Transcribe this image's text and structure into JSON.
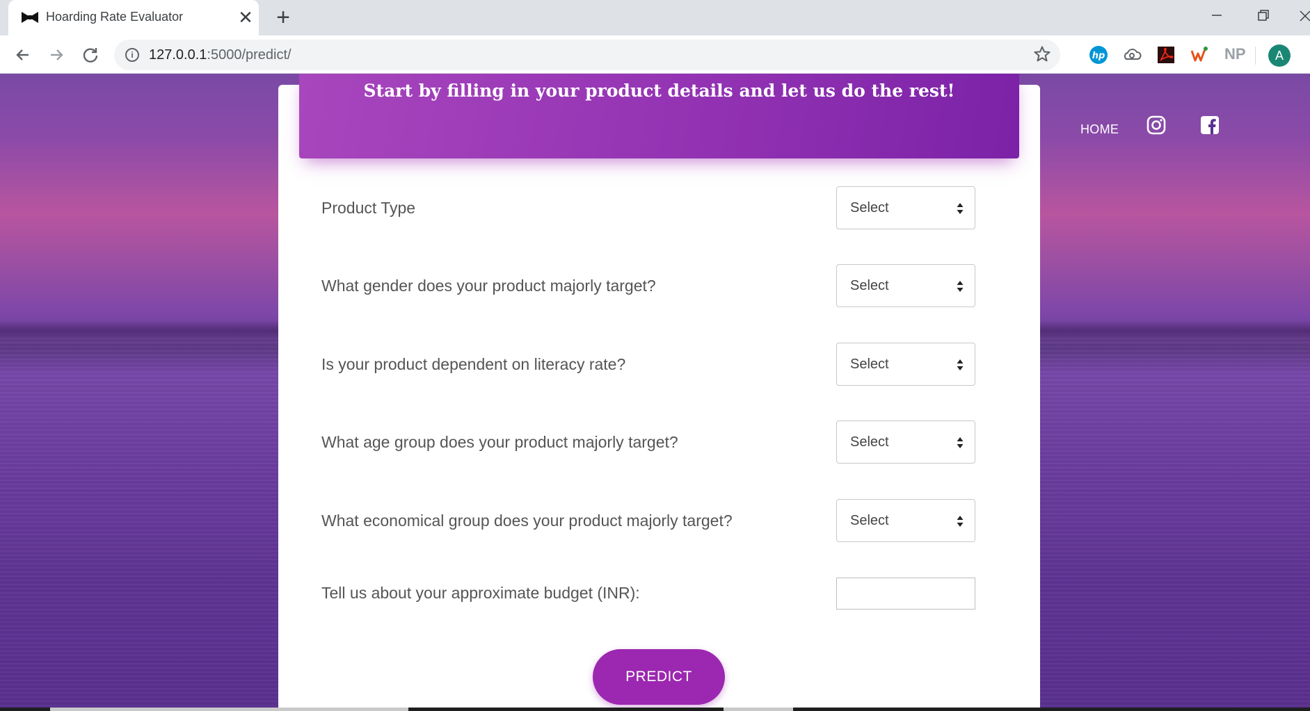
{
  "browser": {
    "tab_title": "Hoarding Rate Evaluator",
    "tab_close_glyph": "✕",
    "new_tab_glyph": "+",
    "url_host": "127.0.0.1",
    "url_path": ":5000/predict/",
    "extension_np": "NP",
    "avatar_letter": "A",
    "icons": [
      "back-arrow-icon",
      "forward-arrow-icon",
      "reload-icon",
      "info-icon",
      "star-icon",
      "hp-icon",
      "cloud-icon",
      "acrobat-icon",
      "office-icon"
    ],
    "avatar_color": "#1a8774"
  },
  "nav": {
    "home_label": "HOME",
    "icons": [
      "instagram-icon",
      "facebook-icon"
    ]
  },
  "form": {
    "header": "Start by filling in your product details and let us do the rest!",
    "fields": [
      {
        "label": "Product Type",
        "value": "Select"
      },
      {
        "label": "What gender does your product majorly target?",
        "value": "Select"
      },
      {
        "label": "Is your product dependent on literacy rate?",
        "value": "Select"
      },
      {
        "label": "What age group does your product majorly target?",
        "value": "Select"
      },
      {
        "label": "What economical group does your product majorly target?",
        "value": "Select"
      }
    ],
    "budget_label": "Tell us about your approximate budget (INR):",
    "budget_value": "",
    "predict_label": "PREDICT"
  },
  "colors": {
    "accent": "#9c27b0",
    "header_gradient_start": "#a846bd",
    "header_gradient_end": "#7b22a7"
  }
}
